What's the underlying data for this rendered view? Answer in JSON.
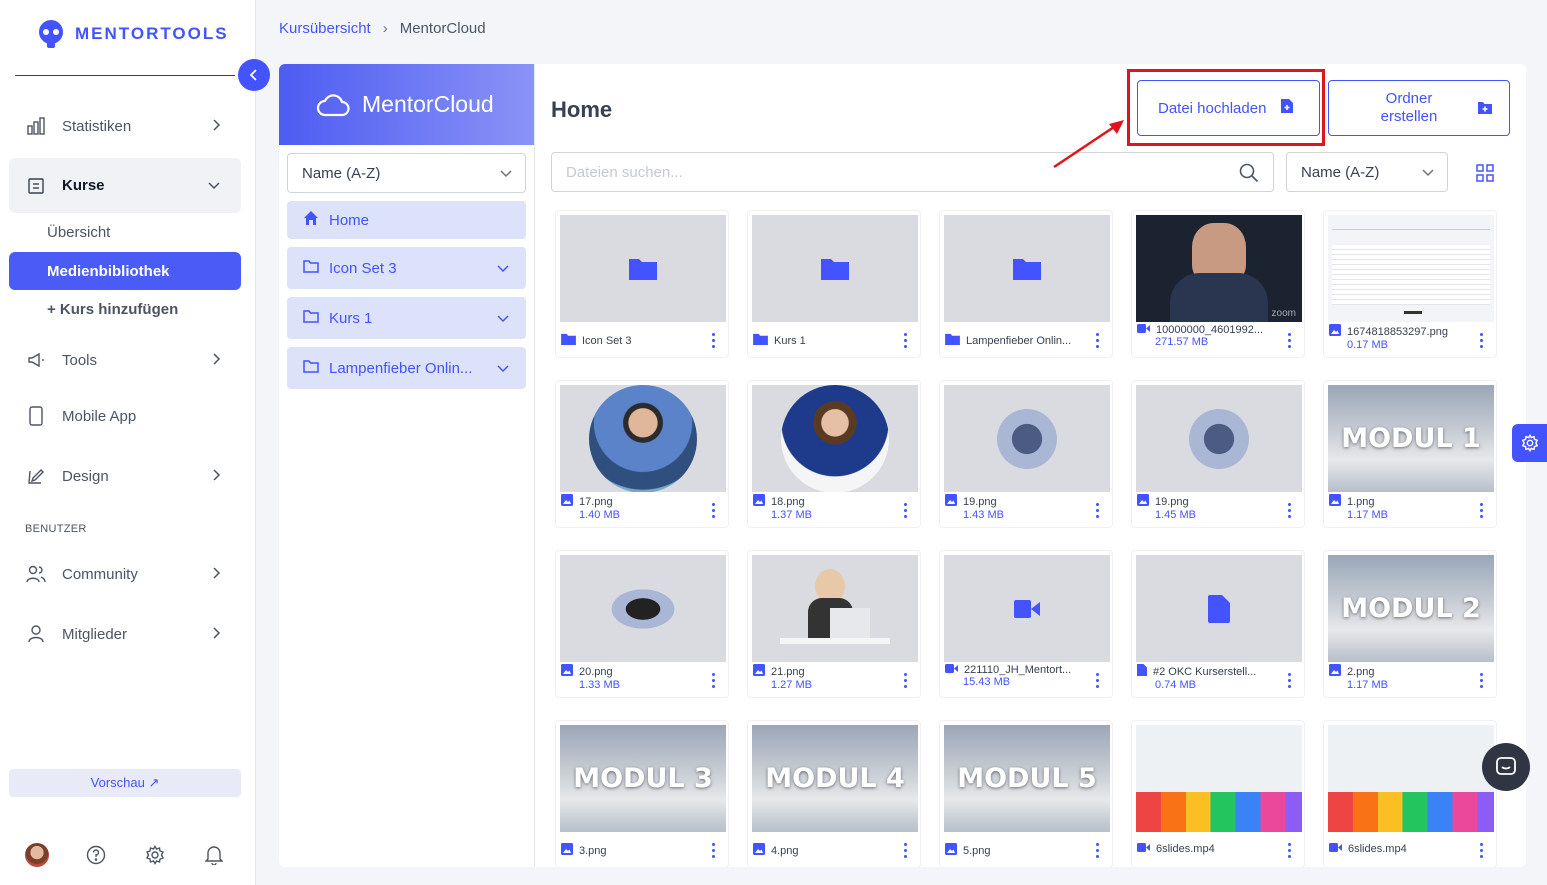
{
  "brand": {
    "name": "MENTORTOOLS"
  },
  "sidebar": {
    "items": [
      {
        "label": "Statistiken"
      },
      {
        "label": "Kurse"
      },
      {
        "label": "Tools"
      },
      {
        "label": "Mobile App"
      },
      {
        "label": "Design"
      },
      {
        "label": "Community"
      },
      {
        "label": "Mitglieder"
      }
    ],
    "sub_items": [
      {
        "label": "Übersicht"
      },
      {
        "label": "Medienbibliothek"
      },
      {
        "label": "+ Kurs hinzufügen"
      }
    ],
    "section_users": "BENUTZER",
    "preview": "Vorschau ↗"
  },
  "breadcrumb": {
    "parent": "Kursübersicht",
    "separator": "›",
    "current": "MentorCloud"
  },
  "cloud": {
    "title": "MentorCloud",
    "sort": "Name (A-Z)",
    "folders": [
      {
        "label": "Home"
      },
      {
        "label": "Icon Set 3"
      },
      {
        "label": "Kurs 1"
      },
      {
        "label": "Lampenfieber Onlin..."
      }
    ]
  },
  "main": {
    "title": "Home",
    "upload_label": "Datei hochladen",
    "folder_label": "Ordner erstellen",
    "search_placeholder": "Dateien suchen...",
    "sort": "Name (A-Z)"
  },
  "files": [
    {
      "name": "Icon Set 3",
      "size": "",
      "type": "folder",
      "thumb": "folder"
    },
    {
      "name": "Kurs 1",
      "size": "",
      "type": "folder",
      "thumb": "folder"
    },
    {
      "name": "Lampenfieber Onlin...",
      "size": "",
      "type": "folder",
      "thumb": "folder"
    },
    {
      "name": "10000000_4601992...",
      "size": "271.57 MB",
      "type": "video",
      "thumb": "zoom",
      "caption": "zoom"
    },
    {
      "name": "1674818853297.png",
      "size": "0.17 MB",
      "type": "image",
      "thumb": "screenshot"
    },
    {
      "name": "17.png",
      "size": "1.40 MB",
      "type": "image",
      "thumb": "round"
    },
    {
      "name": "18.png",
      "size": "1.37 MB",
      "type": "image",
      "thumb": "round2"
    },
    {
      "name": "19.png",
      "size": "1.43 MB",
      "type": "image",
      "thumb": "blob"
    },
    {
      "name": "19.png",
      "size": "1.45 MB",
      "type": "image",
      "thumb": "blob"
    },
    {
      "name": "1.png",
      "size": "1.17 MB",
      "type": "image",
      "thumb": "modul",
      "caption": "MODUL 1"
    },
    {
      "name": "20.png",
      "size": "1.33 MB",
      "type": "image",
      "thumb": "handshake"
    },
    {
      "name": "21.png",
      "size": "1.27 MB",
      "type": "image",
      "thumb": "laptop"
    },
    {
      "name": "221110_JH_Mentort...",
      "size": "15.43 MB",
      "type": "video",
      "thumb": "video"
    },
    {
      "name": "#2 OKC Kurserstell...",
      "size": "0.74 MB",
      "type": "file",
      "thumb": "file"
    },
    {
      "name": "2.png",
      "size": "1.17 MB",
      "type": "image",
      "thumb": "modul",
      "caption": "MODUL 2"
    },
    {
      "name": "3.png",
      "size": "",
      "type": "image",
      "thumb": "modul",
      "caption": "MODUL 3"
    },
    {
      "name": "4.png",
      "size": "",
      "type": "image",
      "thumb": "modul",
      "caption": "MODUL 4"
    },
    {
      "name": "5.png",
      "size": "",
      "type": "image",
      "thumb": "modul",
      "caption": "MODUL 5"
    },
    {
      "name": "6slides.mp4",
      "size": "",
      "type": "video",
      "thumb": "skyline"
    },
    {
      "name": "6slides.mp4",
      "size": "",
      "type": "video",
      "thumb": "skyline"
    }
  ],
  "colors": {
    "accent": "#4353ff",
    "highlight": "#e0141e",
    "chat": "#2f3542"
  }
}
